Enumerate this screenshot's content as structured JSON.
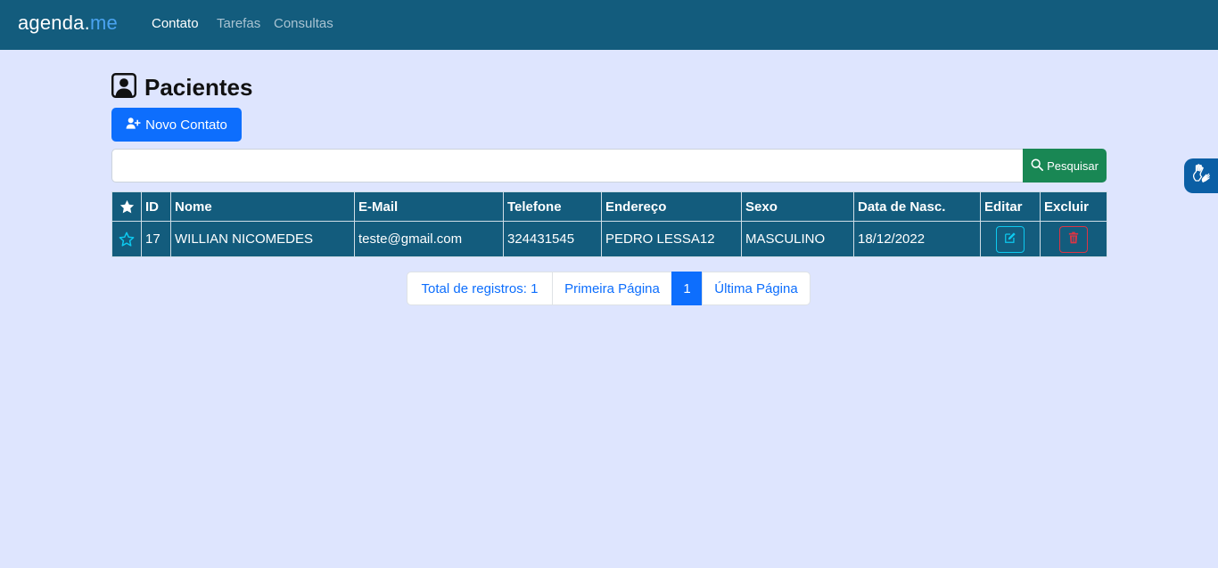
{
  "navbar": {
    "brand_main": "agenda.",
    "brand_accent": "me",
    "links": [
      {
        "label": "Contato",
        "active": true
      },
      {
        "label": "Tarefas",
        "active": false
      },
      {
        "label": "Consultas",
        "active": false
      }
    ]
  },
  "page": {
    "title": "Pacientes",
    "title_icon": "person-square-icon",
    "new_button_label": "Novo Contato",
    "new_button_icon": "person-plus-icon"
  },
  "search": {
    "value": "",
    "placeholder": "",
    "button_label": "Pesquisar",
    "button_icon": "search-icon"
  },
  "table": {
    "header_icon": "star-filled-icon",
    "columns": [
      "ID",
      "Nome",
      "E-Mail",
      "Telefone",
      "Endereço",
      "Sexo",
      "Data de Nasc.",
      "Editar",
      "Excluir"
    ],
    "rows": [
      {
        "favorite_icon": "star-outline-icon",
        "id": "17",
        "nome": "WILLIAN NICOMEDES",
        "email": "teste@gmail.com",
        "telefone": "324431545",
        "endereco": "PEDRO LESSA12",
        "sexo": "MASCULINO",
        "nascimento": "18/12/2022",
        "edit_icon": "pencil-square-icon",
        "delete_icon": "trash-icon"
      }
    ]
  },
  "pagination": {
    "total_label": "Total de registros: 1",
    "first_label": "Primeira Página",
    "current_page": "1",
    "last_label": "Última Página"
  },
  "accessibility": {
    "icon": "sign-language-hands-icon"
  },
  "colors": {
    "navbar": "#135c7d",
    "background": "#dee5fe",
    "primary": "#0d6efd",
    "success": "#198754",
    "info": "#0dcaf0",
    "danger": "#dc3545",
    "brand_accent": "#4aa3f0"
  }
}
